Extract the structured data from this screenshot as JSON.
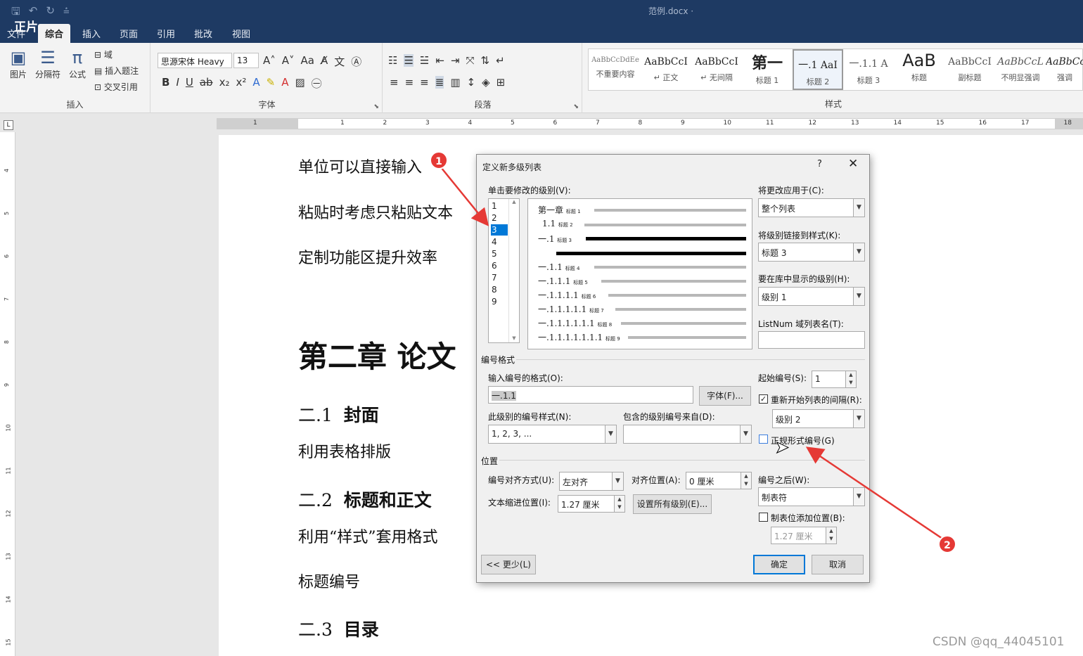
{
  "titlebar": {
    "doc_title": "范例.docx ·",
    "corner_text": "正片",
    "qat_icons": [
      "save-icon",
      "undo-icon",
      "redo-icon",
      "customize-icon"
    ]
  },
  "tabs": [
    "文件",
    "综合",
    "插入",
    "页面",
    "引用",
    "批改",
    "视图"
  ],
  "active_tab": "综合",
  "ribbon": {
    "insert_group": {
      "label": "插入",
      "picture": "图片",
      "separator": "分隔符",
      "formula": "公式",
      "field": "域",
      "caption": "插入题注",
      "crossref": "交叉引用"
    },
    "font_group": {
      "label": "字体",
      "font_name": "思源宋体 Heavy",
      "font_size": "13"
    },
    "para_group": {
      "label": "段落"
    },
    "styles_group": {
      "label": "样式",
      "items": [
        {
          "sample": "AaBbCcDdEe",
          "name": "不重要内容"
        },
        {
          "sample": "AaBbCcI",
          "name": "↵ 正文"
        },
        {
          "sample": "AaBbCcI",
          "name": "↵ 无间隔"
        },
        {
          "sample": "第一",
          "name": "标题 1"
        },
        {
          "sample": "一.1 AaI",
          "name": "标题 2"
        },
        {
          "sample": "一.1.1 A",
          "name": "标题 3"
        },
        {
          "sample": "AaB",
          "name": "标题"
        },
        {
          "sample": "AaBbCcI",
          "name": "副标题"
        },
        {
          "sample": "AaBbCcL",
          "name": "不明显强调"
        },
        {
          "sample": "AaBbCc",
          "name": "强调"
        }
      ]
    }
  },
  "ruler": {
    "ticks": [
      "1",
      "1",
      "2",
      "3",
      "4",
      "5",
      "6",
      "7",
      "8",
      "9",
      "10",
      "11",
      "12",
      "13",
      "14",
      "15",
      "16",
      "17",
      "18"
    ],
    "vticks": [
      "4",
      "5",
      "6",
      "7",
      "8",
      "9",
      "10",
      "11",
      "12",
      "13",
      "14",
      "15"
    ]
  },
  "document": {
    "p1": "单位可以直接输入",
    "p2": "粘贴时考虑只粘贴文本",
    "p3": "定制功能区提升效率",
    "h1": "第二章  论文",
    "h2_1_num": "二.1",
    "h2_1_text": "封面",
    "p4": "利用表格排版",
    "h2_2_num": "二.2",
    "h2_2_text": "标题和正文",
    "p5": "利用“样式”套用格式",
    "p6": "标题编号",
    "h2_3_num": "二.3",
    "h2_3_text": "目录"
  },
  "dialog": {
    "title": "定义新多级列表",
    "help": "?",
    "close": "✕",
    "level_label": "单击要修改的级别(V):",
    "levels": [
      "1",
      "2",
      "3",
      "4",
      "5",
      "6",
      "7",
      "8",
      "9"
    ],
    "selected_level": "3",
    "preview": [
      {
        "num": "第一章",
        "tag": "标题 1"
      },
      {
        "num": "1.1",
        "tag": "标题 2"
      },
      {
        "num": "一.1",
        "tag": "标题 3"
      },
      {
        "num": "一.1.1",
        "tag": "标题 4"
      },
      {
        "num": "一.1.1.1",
        "tag": "标题 5"
      },
      {
        "num": "一.1.1.1.1",
        "tag": "标题 6"
      },
      {
        "num": "一.1.1.1.1.1",
        "tag": "标题 7"
      },
      {
        "num": "一.1.1.1.1.1.1",
        "tag": "标题 8"
      },
      {
        "num": "一.1.1.1.1.1.1.1",
        "tag": "标题 9"
      }
    ],
    "apply_to_label": "将更改应用于(C):",
    "apply_to_value": "整个列表",
    "link_style_label": "将级别链接到样式(K):",
    "link_style_value": "标题 3",
    "gallery_level_label": "要在库中显示的级别(H):",
    "gallery_level_value": "级别 1",
    "listnum_label": "ListNum 域列表名(T):",
    "listnum_value": "",
    "number_format_section": "编号格式",
    "format_input_label": "输入编号的格式(O):",
    "format_input_value": "一.1.1",
    "font_button": "字体(F)...",
    "number_style_label": "此级别的编号样式(N):",
    "number_style_value": "1, 2, 3, ...",
    "include_level_label": "包含的级别编号来自(D):",
    "include_level_value": "",
    "start_at_label": "起始编号(S):",
    "start_at_value": "1",
    "restart_label": "重新开始列表的间隔(R):",
    "restart_value": "级别 2",
    "legal_label": "正规形式编号(G)",
    "position_section": "位置",
    "alignment_label": "编号对齐方式(U):",
    "alignment_value": "左对齐",
    "aligned_at_label": "对齐位置(A):",
    "aligned_at_value": "0 厘米",
    "indent_label": "文本缩进位置(I):",
    "indent_value": "1.27 厘米",
    "set_all_button": "设置所有级别(E)...",
    "follow_label": "编号之后(W):",
    "follow_value": "制表符",
    "tab_stop_label": "制表位添加位置(B):",
    "tab_stop_value": "1.27 厘米",
    "less_button": "<< 更少(L)",
    "ok_button": "确定",
    "cancel_button": "取消"
  },
  "annotations": {
    "badge1": "1",
    "badge2": "2"
  },
  "watermark": "CSDN @qq_44045101",
  "colors": {
    "titlebar": "#1e3a63",
    "accent": "#0078d7",
    "annotation": "#e53935"
  }
}
